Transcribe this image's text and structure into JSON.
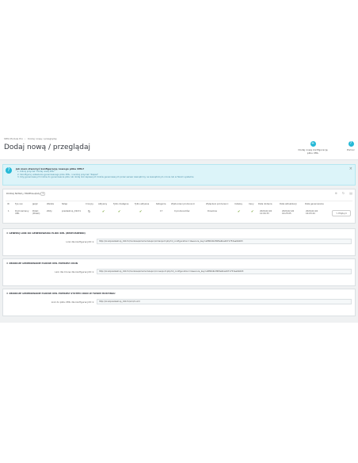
{
  "breadcrumb": [
    "SMS Module Pro",
    "Dodaj nową / przeglądaj"
  ],
  "page_title": "Dodaj nową / przeglądaj",
  "toolbar": {
    "add_label": "Dodaj nową konfigurację pliku XML",
    "help_label": "Pomoc"
  },
  "alert": {
    "question": "Jak mam stworzyć konfigurację nowego pliku XML?",
    "steps": [
      "1. Kliknij przycisk \"Dodaj nową XML\"",
      "2. Skonfiguruj ustawienia generowanego pliku XML, i naciśnij przycisk \"Zapisz\"",
      "3. Użyj generowanych linków do generowania pliku lub dodaj link zapisanych linków generowanych przez serwer zewnętrzny na zewnętrznym cronie lub w Twoim systemie"
    ]
  },
  "list": {
    "title": "Dodaj nową / przeglądaj",
    "count": "1",
    "headers": [
      "ID",
      "Typ cen",
      "Język",
      "Waluta",
      "Sklep",
      "Cronjoy",
      "Aktywny",
      "Tylko dostępne",
      "Tylko aktywne",
      "Kategorie",
      "Wykluczeni producenci",
      "Wyłączeni producenci",
      "Indeksy",
      "Ceny",
      "Data dodania",
      "Data aktualizacji",
      "Data generowania"
    ],
    "row": [
      "1",
      "Domniemany XML",
      "Polski (Polski)",
      "Złoty",
      "prestashop_19131",
      "↻",
      "✔",
      "✔",
      "✔",
      "17",
      "0 producentów",
      "Dowolnie",
      "✔",
      "✔",
      "2020-02-04 12:04:33",
      "2020-02-04 16:25:05",
      "2020-02-04 16:03:44"
    ],
    "action": "Edytuj"
  },
  "links": [
    {
      "title": "Generuj link do generowania pliku XML (bezpośredni)",
      "label": "Link dla konfiguracji ID 1:",
      "value": "http://localprestashop_19131/modules/smsmodulepro/xmlexport.php?id_configuration=1&secure_key=a8f06dbdf4f0e6ba4971753ea6b003"
    },
    {
      "title": "Zbiorcze generowanie plików XML poprzez CRON",
      "label": "Link dla Crona dla konfiguracji ID 1:",
      "value": "http://localprestashop_19131/modules/smsmodulepro/cronexport.php?id_configuration=1&secure_key=a8f06dbdf4f0e6ba4971753ea6b003"
    },
    {
      "title": "Zbiorcze generowanie plików XML poprzez system cron w Twoim hostingu",
      "label": "Link do pliku XML dla konfiguracji ID 1:",
      "value": "http://localprestashop_19131/xml/1.xml"
    }
  ],
  "colors": {
    "accent": "#25b9d7",
    "alert_bg": "#dcf4f9",
    "check": "#6c9b28"
  }
}
